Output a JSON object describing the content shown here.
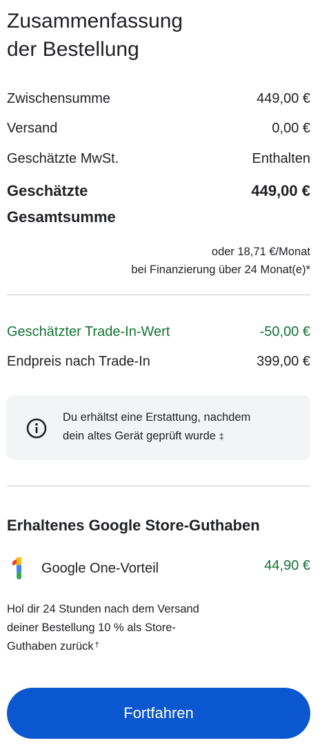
{
  "summary": {
    "title_line1": "Zusammenfassung",
    "title_line2": "der Bestellung",
    "subtotal": {
      "label": "Zwischensumme",
      "value": "449,00 €"
    },
    "shipping": {
      "label": "Versand",
      "value": "0,00 €"
    },
    "vat": {
      "label": "Geschätzte MwSt.",
      "value": "Enthalten"
    },
    "total": {
      "label_line1": "Geschätzte",
      "label_line2": "Gesamtsumme",
      "value": "449,00 €"
    },
    "financing_line1": "oder 18,71 €/Monat",
    "financing_line2": "bei Finanzierung über 24 Monat(e)*"
  },
  "trade_in": {
    "estimated": {
      "label": "Geschätzter Trade-In-Wert",
      "value": "-50,00 €"
    },
    "final": {
      "label": "Endpreis nach Trade-In",
      "value": "399,00 €"
    },
    "info_text_line1": "Du erhältst eine Erstattung, nachdem",
    "info_text_line2": "dein altes Gerät geprüft wurde",
    "info_marker": "‡"
  },
  "credit": {
    "title": "Erhaltenes Google Store-Guthaben",
    "item_label": "Google One-Vorteil",
    "item_value": "44,90 €",
    "description_line1": "Hol dir 24 Stunden nach dem Versand",
    "description_line2": "deiner Bestellung 10 % als Store-",
    "description_line3": "Guthaben zurück",
    "description_marker": "†"
  },
  "cta": {
    "label": "Fortfahren"
  },
  "colors": {
    "accent": "#0b57d0",
    "positive": "#137333",
    "info_bg": "#f3f4f5",
    "divider": "#c4c7c5"
  },
  "icons": [
    "info-icon",
    "google-one-logo"
  ]
}
